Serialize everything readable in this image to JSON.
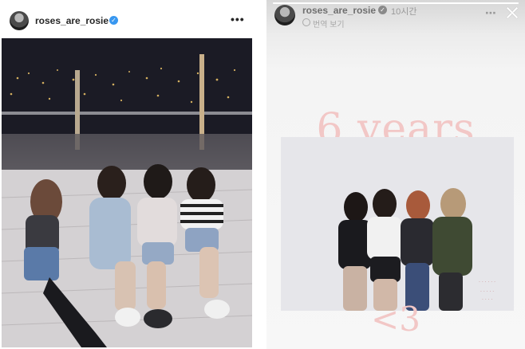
{
  "post": {
    "username": "roses_are_rosie",
    "verified_icon": "verified-badge-icon",
    "more_icon": "more-options-icon",
    "more_glyph": "•••"
  },
  "story": {
    "username": "roses_are_rosie",
    "timestamp": "10시간",
    "see_translation": "번역 보기",
    "text_top": "6 years",
    "text_bottom": "<3",
    "progress": 1.0,
    "verified_icon": "verified-badge-icon",
    "close_icon": "close-icon",
    "accent_pink": "#f2c7c6"
  }
}
